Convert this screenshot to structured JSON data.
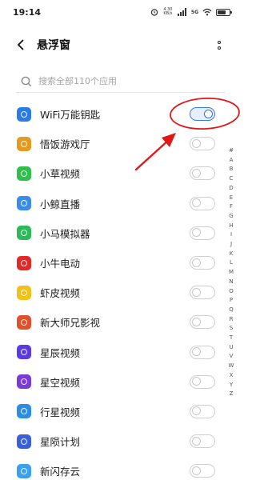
{
  "status_bar": {
    "time": "19:14",
    "net_speed": "4.30 KB/s",
    "network": "5G"
  },
  "header": {
    "title": "悬浮窗"
  },
  "search": {
    "placeholder": "搜索全部110个应用"
  },
  "apps": [
    {
      "name": "WiFi万能钥匙",
      "icon": "wifi-key-icon",
      "color": "#2b7be5",
      "enabled": true
    },
    {
      "name": "悟饭游戏厅",
      "icon": "wufan-game-icon",
      "color": "#e39a1e",
      "enabled": false
    },
    {
      "name": "小草视频",
      "icon": "grass-video-icon",
      "color": "#2fbf4a",
      "enabled": false
    },
    {
      "name": "小鲸直播",
      "icon": "whale-live-icon",
      "color": "#3a8ce8",
      "enabled": false
    },
    {
      "name": "小马模拟器",
      "icon": "pony-emulator-icon",
      "color": "#2cb95a",
      "enabled": false
    },
    {
      "name": "小牛电动",
      "icon": "niu-electric-icon",
      "color": "#e02a2a",
      "enabled": false
    },
    {
      "name": "虾皮视频",
      "icon": "shrimp-video-icon",
      "color": "#f0c21a",
      "enabled": false
    },
    {
      "name": "新大师兄影视",
      "icon": "master-video-icon",
      "color": "#e0502b",
      "enabled": false
    },
    {
      "name": "星辰视频",
      "icon": "star-video-icon",
      "color": "#5b3be0",
      "enabled": false
    },
    {
      "name": "星空视频",
      "icon": "starry-video-icon",
      "color": "#7a3bd6",
      "enabled": false
    },
    {
      "name": "行星视频",
      "icon": "planet-video-icon",
      "color": "#2c8de6",
      "enabled": false
    },
    {
      "name": "星陨计划",
      "icon": "meteor-plan-icon",
      "color": "#3b5fd8",
      "enabled": false
    },
    {
      "name": "新闪存云",
      "icon": "flash-cloud-icon",
      "color": "#3aa0f0",
      "enabled": false
    }
  ],
  "index_letters": [
    "#",
    "A",
    "B",
    "C",
    "D",
    "E",
    "F",
    "G",
    "H",
    "I",
    "J",
    "K",
    "L",
    "M",
    "N",
    "O",
    "P",
    "Q",
    "R",
    "S",
    "T",
    "U",
    "V",
    "W",
    "X",
    "Y",
    "Z"
  ],
  "colors": {
    "accent": "#2f6fd6",
    "annotation": "#e01818"
  }
}
